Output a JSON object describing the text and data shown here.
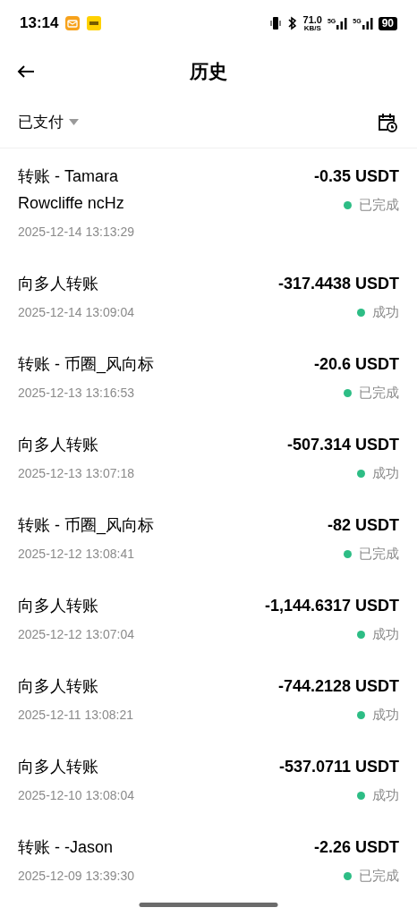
{
  "status_bar": {
    "time": "13:14",
    "speed": "71.0",
    "speed_unit": "KB/S",
    "networks": [
      "5G",
      "5G"
    ],
    "battery": "90"
  },
  "header": {
    "title": "历史"
  },
  "filter": {
    "label": "已支付"
  },
  "transactions": [
    {
      "title": "转账 - Tamara Rowcliffe ncHz",
      "date": "2025-12-14 13:13:29",
      "amount": "-0.35 USDT",
      "status": "已完成",
      "color": "#2dbd85"
    },
    {
      "title": "向多人转账",
      "date": "2025-12-14 13:09:04",
      "amount": "-317.4438 USDT",
      "status": "成功",
      "color": "#2dbd85"
    },
    {
      "title": "转账 - 币圈_风向标",
      "date": "2025-12-13 13:16:53",
      "amount": "-20.6 USDT",
      "status": "已完成",
      "color": "#2dbd85"
    },
    {
      "title": "向多人转账",
      "date": "2025-12-13 13:07:18",
      "amount": "-507.314 USDT",
      "status": "成功",
      "color": "#2dbd85"
    },
    {
      "title": "转账 - 币圈_风向标",
      "date": "2025-12-12 13:08:41",
      "amount": "-82 USDT",
      "status": "已完成",
      "color": "#2dbd85"
    },
    {
      "title": "向多人转账",
      "date": "2025-12-12 13:07:04",
      "amount": "-1,144.6317 USDT",
      "status": "成功",
      "color": "#2dbd85"
    },
    {
      "title": "向多人转账",
      "date": "2025-12-11 13:08:21",
      "amount": "-744.2128 USDT",
      "status": "成功",
      "color": "#2dbd85"
    },
    {
      "title": "向多人转账",
      "date": "2025-12-10 13:08:04",
      "amount": "-537.0711 USDT",
      "status": "成功",
      "color": "#2dbd85"
    },
    {
      "title": "转账 - -Jason",
      "date": "2025-12-09 13:39:30",
      "amount": "-2.26 USDT",
      "status": "已完成",
      "color": "#2dbd85"
    }
  ]
}
